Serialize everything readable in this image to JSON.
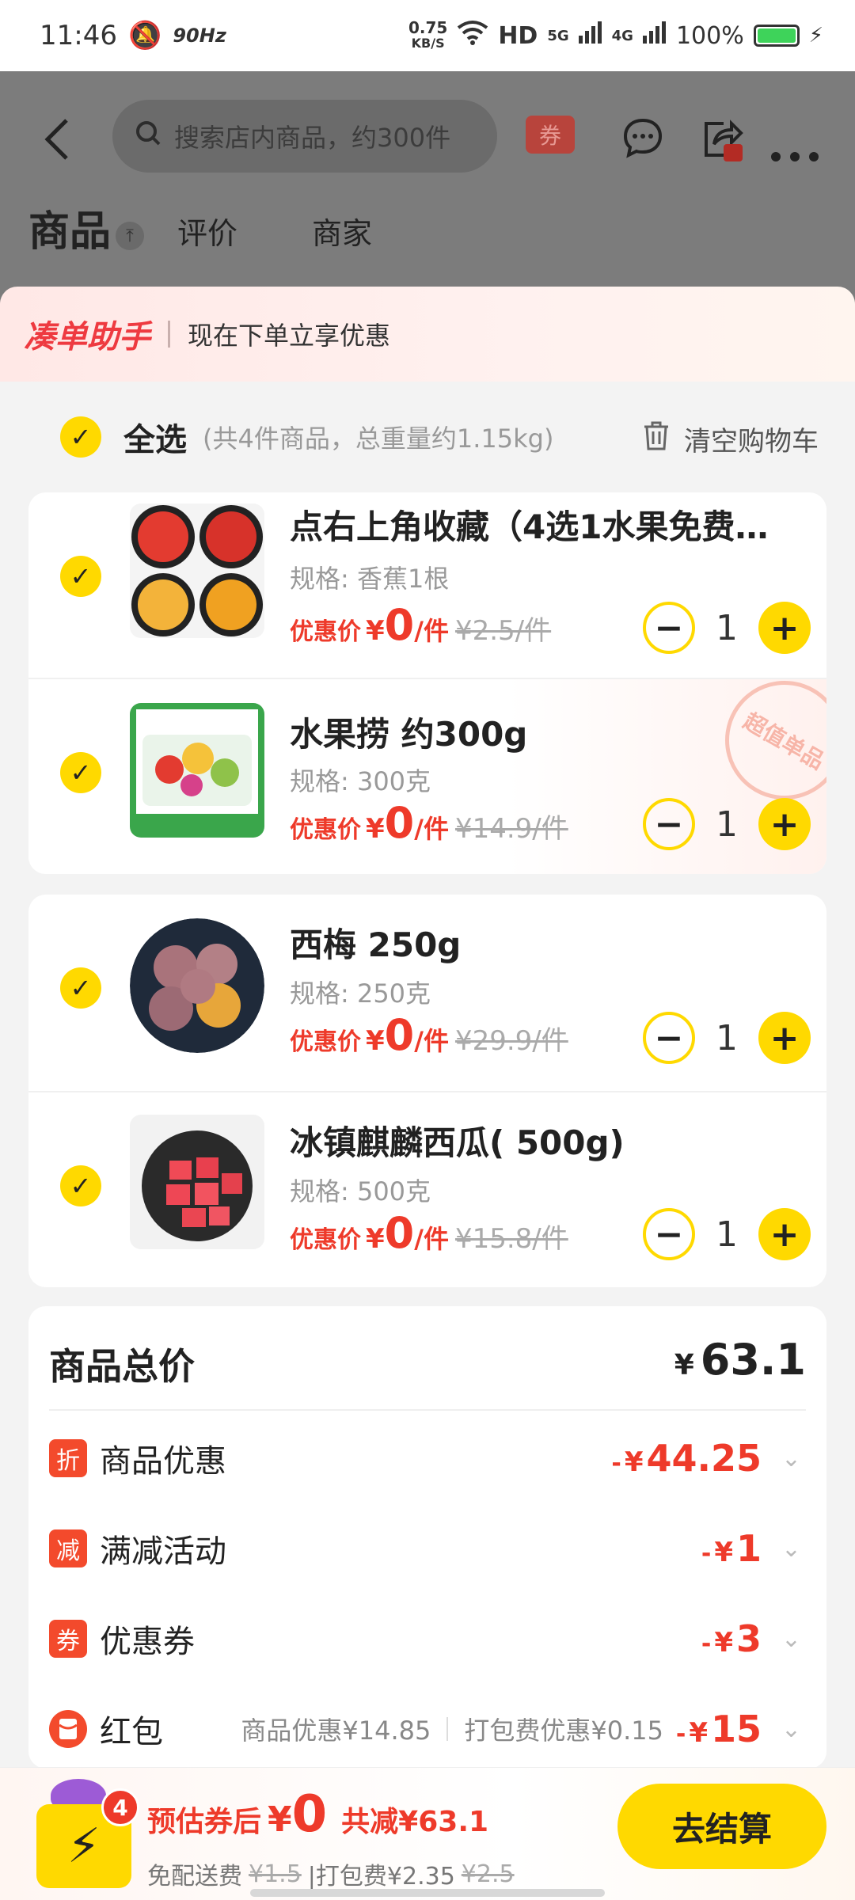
{
  "status_bar": {
    "time": "11:46",
    "refresh": "90Hz",
    "speed_value": "0.75",
    "speed_unit": "KB/S",
    "hd": "HD",
    "net1": "5G",
    "net2": "4G",
    "battery": "100%"
  },
  "header": {
    "search_placeholder": "搜索店内商品，约300件",
    "coupon_tag": "券"
  },
  "tabs": [
    {
      "label": "商品"
    },
    {
      "label": "评价"
    },
    {
      "label": "商家"
    }
  ],
  "helper": {
    "title": "凑单助手",
    "text": "现在下单立享优惠"
  },
  "select_all": {
    "label": "全选",
    "info": "(共4件商品，总重量约1.15kg)",
    "clear": "清空购物车"
  },
  "items": [
    {
      "name": "点右上角收藏（4选1水果免费…",
      "spec": "规格: 香蕉1根",
      "price_label": "优惠价",
      "currency": "¥",
      "price": "0",
      "unit": "/件",
      "original": "¥2.5/件",
      "qty": "1"
    },
    {
      "name": "水果捞 约300g",
      "spec": "规格: 300克",
      "price_label": "优惠价",
      "currency": "¥",
      "price": "0",
      "unit": "/件",
      "original": "¥14.9/件",
      "qty": "1",
      "stamp": "超值单品"
    },
    {
      "name": "西梅 250g",
      "spec": "规格: 250克",
      "price_label": "优惠价",
      "currency": "¥",
      "price": "0",
      "unit": "/件",
      "original": "¥29.9/件",
      "qty": "1"
    },
    {
      "name": "冰镇麒麟西瓜( 500g)",
      "spec": "规格: 500克",
      "price_label": "优惠价",
      "currency": "¥",
      "price": "0",
      "unit": "/件",
      "original": "¥15.8/件",
      "qty": "1"
    }
  ],
  "summary": {
    "title": "商品总价",
    "currency": "¥",
    "total": "63.1",
    "rows": [
      {
        "badge": "折",
        "label": "商品优惠",
        "prefix": "-",
        "currency": "¥",
        "value": "44.25"
      },
      {
        "badge": "减",
        "label": "满减活动",
        "prefix": "-",
        "currency": "¥",
        "value": "1"
      },
      {
        "badge": "券",
        "label": "优惠券",
        "prefix": "-",
        "currency": "¥",
        "value": "3"
      },
      {
        "badge": "",
        "label": "红包",
        "prefix": "-",
        "currency": "¥",
        "value": "15",
        "sub1": "商品优惠¥14.85",
        "sub2": "打包费优惠¥0.15"
      }
    ]
  },
  "bottom": {
    "cart_count": "4",
    "est_label": "预估券后",
    "currency": "¥",
    "est_value": "0",
    "saved": "共减¥63.1",
    "ship_label": "免配送费",
    "ship_orig": "¥1.5",
    "pack_label": "|打包费¥2.35",
    "pack_orig": "¥2.5",
    "checkout": "去结算"
  },
  "colors": {
    "accent_yellow": "#ffd900",
    "price_red": "#ee3a2a",
    "dim_overlay": "#7c7c7c"
  }
}
